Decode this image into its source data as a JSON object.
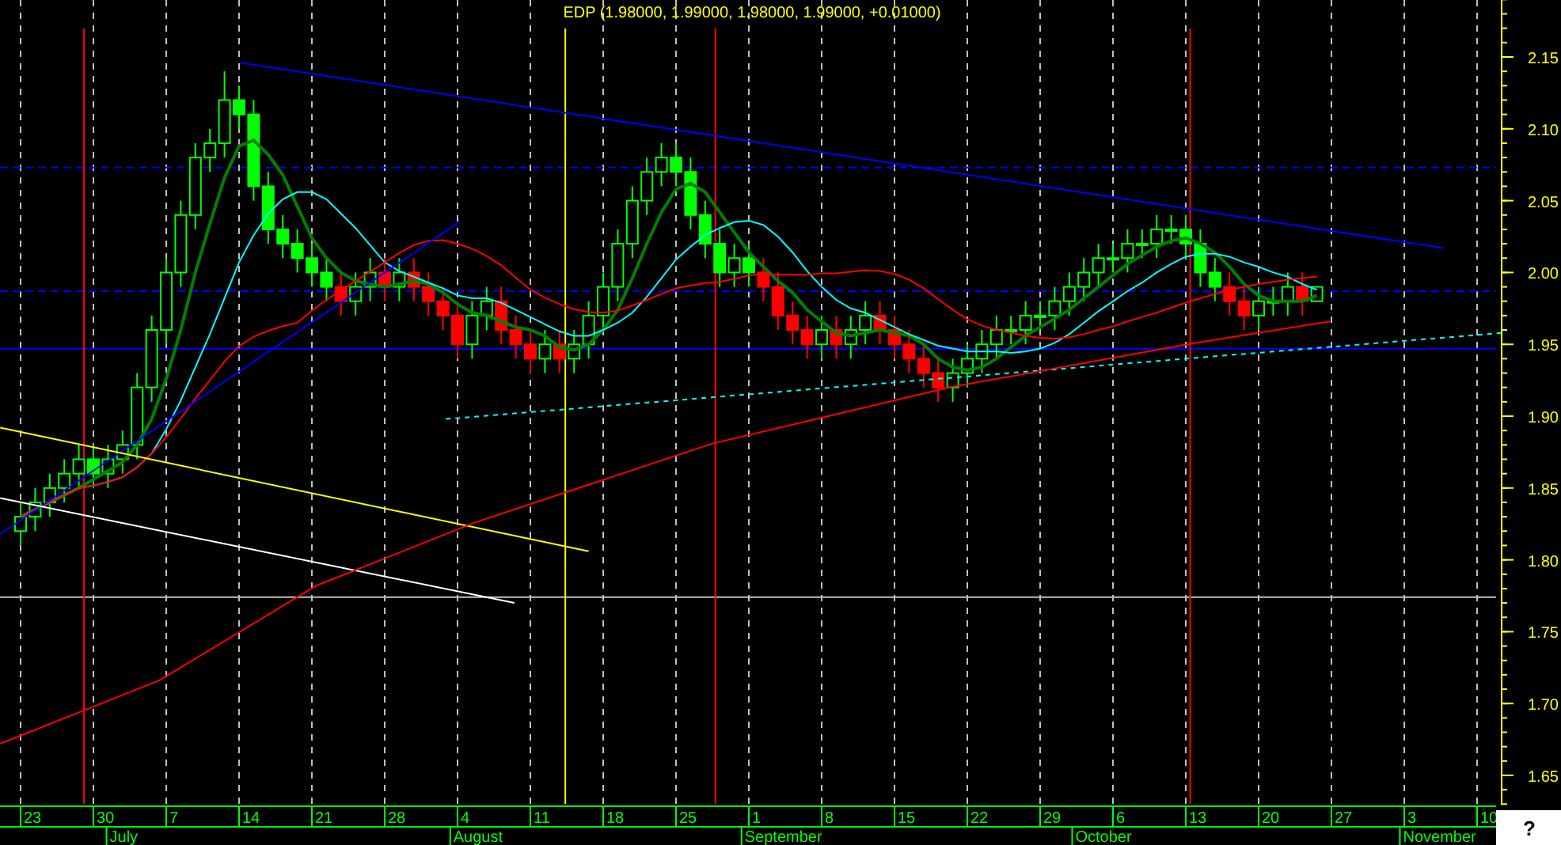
{
  "chart_title": "EDP (1.98000, 1.99000, 1.98000, 1.99000, +0.01000)",
  "price_labels": [
    "2.15",
    "2.10",
    "2.05",
    "2.00",
    "1.95",
    "1.90",
    "1.85",
    "1.80",
    "1.75",
    "1.70",
    "1.65"
  ],
  "day_labels": [
    "23",
    "30",
    "7",
    "14",
    "21",
    "28",
    "4",
    "11",
    "18",
    "25",
    "1",
    "8",
    "15",
    "22",
    "29",
    "6",
    "13",
    "20",
    "27",
    "3",
    "10"
  ],
  "month_labels": [
    "July",
    "August",
    "September",
    "October",
    "November"
  ],
  "help_button": "?"
}
